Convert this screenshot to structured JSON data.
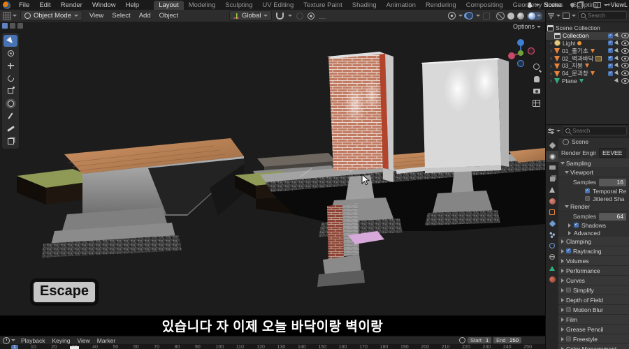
{
  "topbar": {
    "menus": [
      "File",
      "Edit",
      "Render",
      "Window",
      "Help"
    ],
    "tabs": [
      {
        "label": "Layout",
        "cls": "active"
      },
      {
        "label": "Modeling",
        "cls": ""
      },
      {
        "label": "Sculpting",
        "cls": ""
      },
      {
        "label": "UV Editing",
        "cls": ""
      },
      {
        "label": "Texture Paint",
        "cls": ""
      },
      {
        "label": "Shading",
        "cls": ""
      },
      {
        "label": "Animation",
        "cls": ""
      },
      {
        "label": "Rendering",
        "cls": ""
      },
      {
        "label": "Compositing",
        "cls": ""
      },
      {
        "label": "Geometry Nodes",
        "cls": ""
      },
      {
        "label": "Scripting",
        "cls": ""
      },
      {
        "label": "+",
        "cls": "plus"
      }
    ],
    "scene_name": "Scene",
    "viewlayer_name": "ViewL"
  },
  "viewport_header": {
    "mode": "Object Mode",
    "menus": [
      "View",
      "Select",
      "Add",
      "Object"
    ],
    "orientation": "Global",
    "options_label": "Options"
  },
  "viewport_tools": [
    {
      "cls": "t-select active"
    },
    {
      "cls": "t-cursor"
    },
    {
      "cls": "t-move"
    },
    {
      "cls": "t-rotate"
    },
    {
      "cls": "t-scale"
    },
    {
      "cls": "t-transform"
    },
    {
      "cls": "t-annotate"
    },
    {
      "cls": "t-measure"
    },
    {
      "cls": "t-cube"
    }
  ],
  "outliner": {
    "search_placeholder": "Search",
    "items": [
      {
        "label": "Scene Collection",
        "icon": "oi-collection",
        "cls": "root",
        "arrow": "",
        "right": "r-none",
        "badge": ""
      },
      {
        "label": "Collection",
        "icon": "oi-collection",
        "cls": "selected",
        "arrow": "",
        "right": "r-full",
        "badge": ""
      },
      {
        "label": "Light",
        "icon": "oi-light",
        "cls": "",
        "arrow": "›",
        "right": "r-full",
        "badge": "b-light"
      },
      {
        "label": "01_줄기초",
        "icon": "oi-mesh",
        "cls": "",
        "arrow": "›",
        "right": "r-full",
        "badge": "b-mesh"
      },
      {
        "label": "02_벽과바닥",
        "icon": "oi-mesh",
        "cls": "",
        "arrow": "›",
        "right": "r-full",
        "badge": "b-img"
      },
      {
        "label": "03_지붕",
        "icon": "oi-mesh",
        "cls": "",
        "arrow": "›",
        "right": "r-full",
        "badge": "b-mesh"
      },
      {
        "label": "04_문과창",
        "icon": "oi-mesh",
        "cls": "",
        "arrow": "›",
        "right": "r-full",
        "badge": "b-bone"
      },
      {
        "label": "Plane",
        "icon": "oi-mesh-green",
        "cls": "",
        "arrow": "›",
        "right": "r-plane",
        "badge": "b-green"
      }
    ]
  },
  "properties": {
    "search_placeholder": "Search",
    "breadcrumb": "Scene",
    "render_engine_label": "Render Engine",
    "render_engine_value": "EEVEE",
    "sampling_title": "Sampling",
    "viewport_title": "Viewport",
    "samples_label": "Samples",
    "viewport_samples": "16",
    "temporal_label": "Temporal Re",
    "jittered_label": "Jittered Sha",
    "render_title": "Render",
    "render_samples": "64",
    "shadows_label": "Shadows",
    "advanced_label": "Advanced",
    "sections": [
      {
        "label": "Clamping",
        "check": "chk-none"
      },
      {
        "label": "Raytracing",
        "check": "chk-on"
      },
      {
        "label": "Volumes",
        "check": "chk-none"
      },
      {
        "label": "Performance",
        "check": "chk-none"
      },
      {
        "label": "Curves",
        "check": "chk-none"
      },
      {
        "label": "Simplify",
        "check": "chk-off"
      },
      {
        "label": "Depth of Field",
        "check": "chk-none"
      },
      {
        "label": "Motion Blur",
        "check": "chk-off"
      },
      {
        "label": "Film",
        "check": "chk-none"
      },
      {
        "label": "Grease Pencil",
        "check": "chk-none"
      },
      {
        "label": "Freestyle",
        "check": "chk-off"
      },
      {
        "label": "Color Management",
        "check": "chk-none"
      }
    ],
    "tabs": [
      {
        "cls": "ic-tool"
      },
      {
        "cls": "ic-render active"
      },
      {
        "cls": "ic-output"
      },
      {
        "cls": "ic-viewlayer"
      },
      {
        "cls": "ic-scene"
      },
      {
        "cls": "ic-world"
      },
      {
        "cls": "ic-object"
      },
      {
        "cls": "ic-mod"
      },
      {
        "cls": "ic-particles"
      },
      {
        "cls": "ic-physics"
      },
      {
        "cls": "ic-constraints"
      },
      {
        "cls": "ic-data"
      },
      {
        "cls": "ic-material"
      }
    ]
  },
  "timeline": {
    "menus": [
      "Playback",
      "Keying",
      "View",
      "Marker"
    ],
    "start_label": "Start",
    "start_value": "1",
    "end_label": "End",
    "end_value": "250",
    "ticks": [
      {
        "label": "1",
        "cls": "current"
      },
      {
        "label": "10",
        "cls": ""
      },
      {
        "label": "20",
        "cls": ""
      },
      {
        "label": "30",
        "cls": ""
      },
      {
        "label": "40",
        "cls": ""
      },
      {
        "label": "50",
        "cls": ""
      },
      {
        "label": "60",
        "cls": ""
      },
      {
        "label": "70",
        "cls": ""
      },
      {
        "label": "80",
        "cls": ""
      },
      {
        "label": "90",
        "cls": ""
      },
      {
        "label": "100",
        "cls": ""
      },
      {
        "label": "110",
        "cls": ""
      },
      {
        "label": "120",
        "cls": ""
      },
      {
        "label": "130",
        "cls": ""
      },
      {
        "label": "140",
        "cls": ""
      },
      {
        "label": "150",
        "cls": ""
      },
      {
        "label": "160",
        "cls": ""
      },
      {
        "label": "170",
        "cls": ""
      },
      {
        "label": "180",
        "cls": ""
      },
      {
        "label": "190",
        "cls": ""
      },
      {
        "label": "200",
        "cls": ""
      },
      {
        "label": "210",
        "cls": ""
      },
      {
        "label": "220",
        "cls": ""
      },
      {
        "label": "230",
        "cls": ""
      },
      {
        "label": "240",
        "cls": ""
      },
      {
        "label": "250",
        "cls": ""
      }
    ]
  },
  "subtitle": "있습니다 자 이제 오늘 바닥이랑 벽이랑",
  "escape_key": "Escape"
}
